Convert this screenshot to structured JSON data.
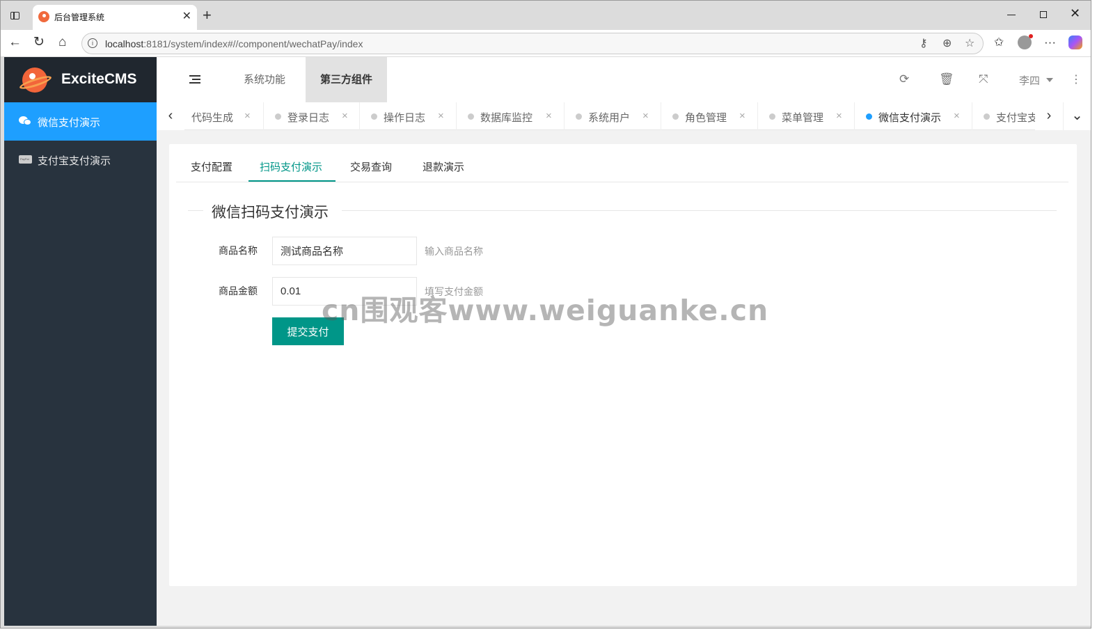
{
  "browser": {
    "tab_title": "后台管理系统",
    "url_host": "localhost",
    "url_rest": ":8181/system/index#//component/wechatPay/index"
  },
  "app": {
    "logo_text": "ExciteCMS"
  },
  "sidebar": {
    "items": [
      {
        "label": "微信支付演示",
        "icon": "wechat-icon",
        "active": true
      },
      {
        "label": "支付宝支付演示",
        "icon": "card-icon",
        "active": false
      }
    ]
  },
  "header": {
    "nav": [
      {
        "label": "系统功能",
        "active": false
      },
      {
        "label": "第三方组件",
        "active": true
      }
    ],
    "user": "李四"
  },
  "page_tabs": [
    {
      "label": "代码生成",
      "active": false
    },
    {
      "label": "登录日志",
      "active": false
    },
    {
      "label": "操作日志",
      "active": false
    },
    {
      "label": "数据库监控",
      "active": false
    },
    {
      "label": "系统用户",
      "active": false
    },
    {
      "label": "角色管理",
      "active": false
    },
    {
      "label": "菜单管理",
      "active": false
    },
    {
      "label": "微信支付演示",
      "active": true
    },
    {
      "label": "支付宝支付",
      "active": false
    }
  ],
  "content": {
    "subtabs": [
      "支付配置",
      "扫码支付演示",
      "交易查询",
      "退款演示"
    ],
    "active_subtab": "扫码支付演示",
    "legend": "微信扫码支付演示",
    "form": {
      "product_name_label": "商品名称",
      "product_name_value": "测试商品名称",
      "product_name_hint": "输入商品名称",
      "amount_label": "商品金额",
      "amount_value": "0.01",
      "amount_hint": "填写支付金额",
      "submit_label": "提交支付"
    }
  },
  "watermark": "cn围观客www.weiguanke.cn",
  "colors": {
    "sidebar_bg": "#28333e",
    "accent_blue": "#1e9fff",
    "accent_green": "#009688"
  }
}
